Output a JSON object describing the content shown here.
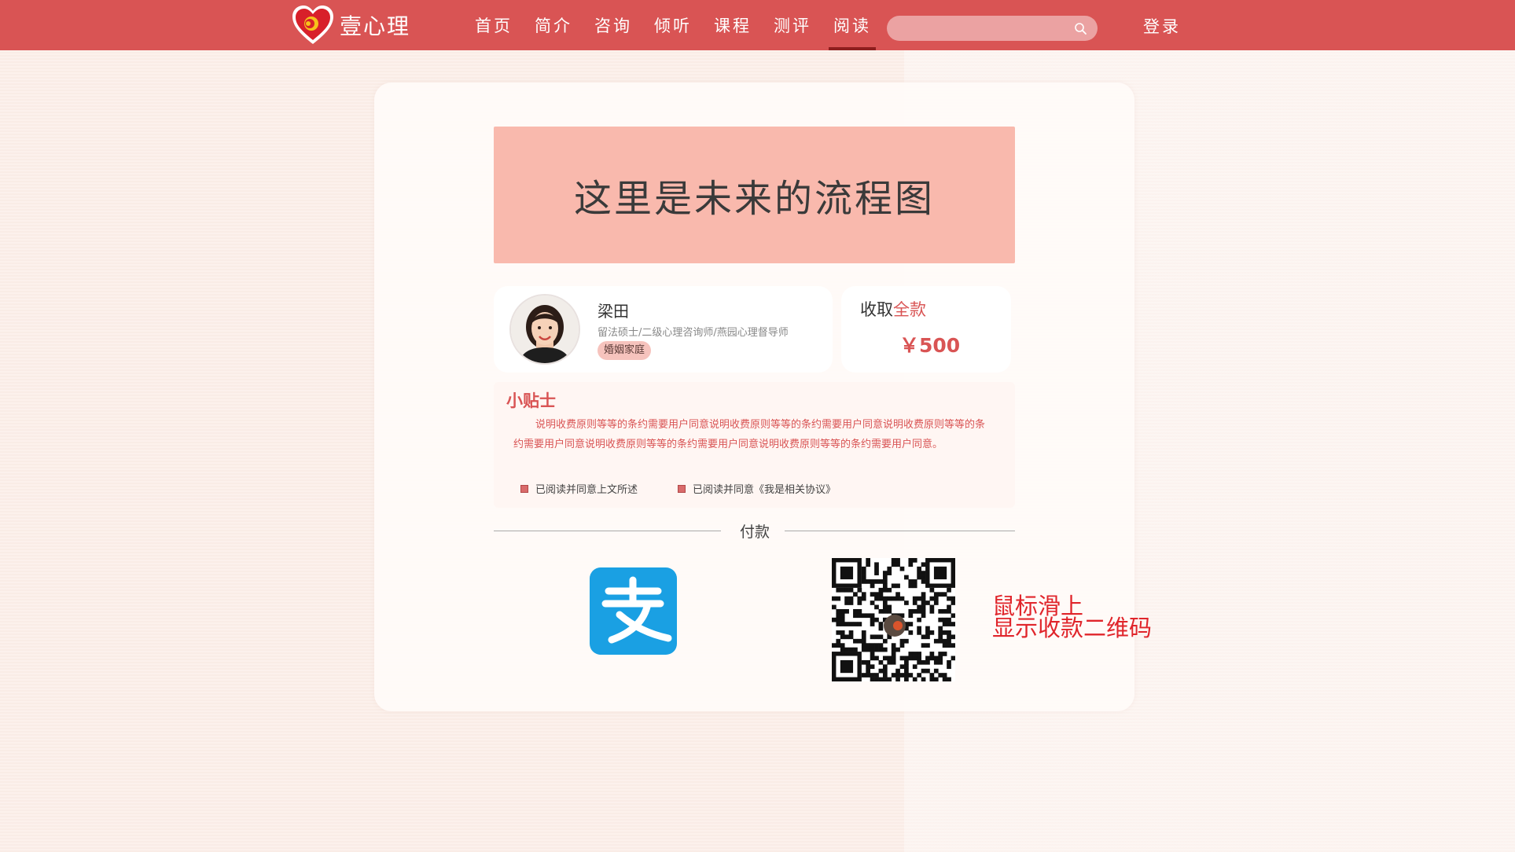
{
  "brand": {
    "name": "壹心理"
  },
  "nav": {
    "items": [
      {
        "label": "首页"
      },
      {
        "label": "简介"
      },
      {
        "label": "咨询"
      },
      {
        "label": "倾听"
      },
      {
        "label": "课程"
      },
      {
        "label": "测评"
      },
      {
        "label": "阅读"
      }
    ],
    "active": "阅读"
  },
  "search": {
    "placeholder": ""
  },
  "header": {
    "login_label": "登录"
  },
  "main": {
    "flow_placeholder": "这里是未来的流程图",
    "counselor": {
      "name": "梁田",
      "title": "留法硕士/二级心理咨询师/燕园心理督导师",
      "tag": "婚姻家庭"
    },
    "fee": {
      "label": "收取",
      "label_accent": "全款",
      "price": "￥500"
    },
    "tips": {
      "title": "小贴士",
      "body": "说明收费原则等等的条约需要用户同意说明收费原则等等的条约需要用户同意说明收费原则等等的条约需要用户同意说明收费原则等等的条约需要用户同意说明收费原则等等的条约需要用户同意。",
      "agree1": "已阅读并同意上文所述",
      "agree2": "已阅读并同意《我是相关协议》"
    },
    "payment": {
      "label": "付款",
      "alipay_icon": "alipay-icon",
      "qr_hint_line1": "鼠标滑上",
      "qr_hint_line2": "显示收款二维码"
    }
  },
  "colors": {
    "brand_red": "#d95454",
    "flow_bg": "#f9b9ad",
    "alipay_blue": "#1aa0e3",
    "hint_red": "#e0252b"
  }
}
